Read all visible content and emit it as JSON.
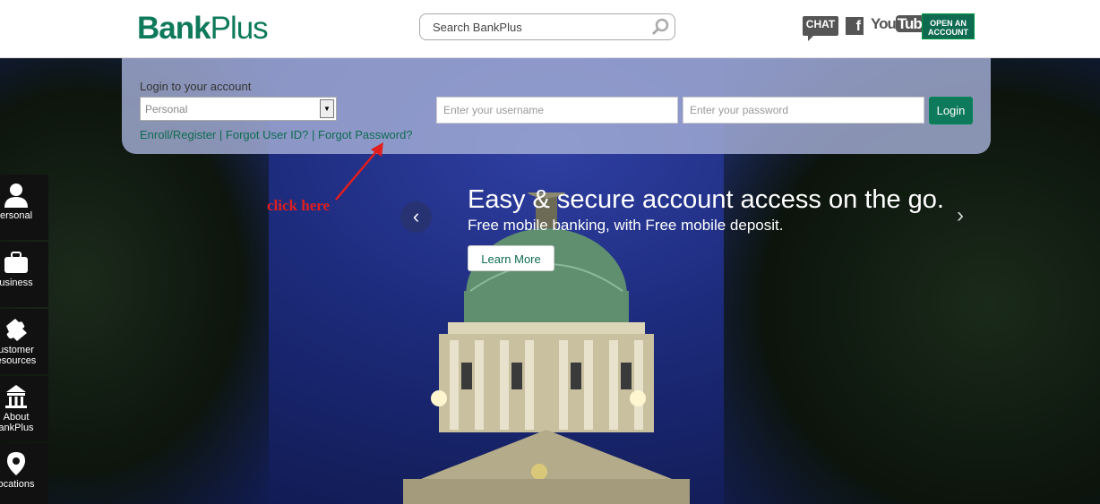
{
  "header": {
    "logo_part1": "Bank",
    "logo_part2": "Plus",
    "search_placeholder": "Search BankPlus",
    "chat_label": "CHAT",
    "facebook_label": "f",
    "youtube_you": "You",
    "youtube_tube": "Tube",
    "open_account_line1": "OPEN AN",
    "open_account_line2": "ACCOUNT"
  },
  "login": {
    "title": "Login to your account",
    "account_type": "Personal",
    "username_placeholder": "Enter your username",
    "password_placeholder": "Enter your password",
    "login_button": "Login",
    "enroll_link": "Enroll/Register",
    "forgot_user_link": "Forgot User ID?",
    "forgot_password_link": "Forgot Password?",
    "separator": "|"
  },
  "sidenav": {
    "items": [
      {
        "label": "Personal",
        "icon": "person-icon"
      },
      {
        "label": "Business",
        "icon": "briefcase-icon"
      },
      {
        "label": "Customer Resources",
        "icon": "puzzle-icon"
      },
      {
        "label": "About BankPlus",
        "icon": "building-icon"
      },
      {
        "label": "Locations",
        "icon": "map-pin-icon"
      }
    ],
    "labels_visible": [
      "ersonal",
      "usiness",
      "ustomer",
      "esources",
      "About",
      "ankPlus",
      "ocations"
    ]
  },
  "slider": {
    "title": "Easy & secure account access on the go.",
    "subtitle": "Free mobile banking, with Free mobile deposit.",
    "button": "Learn More",
    "prev": "‹",
    "next": "›"
  },
  "annotation": {
    "text": "click here"
  },
  "colors": {
    "brand_green": "#0e7a5b",
    "annotation_red": "#e01e1e"
  }
}
